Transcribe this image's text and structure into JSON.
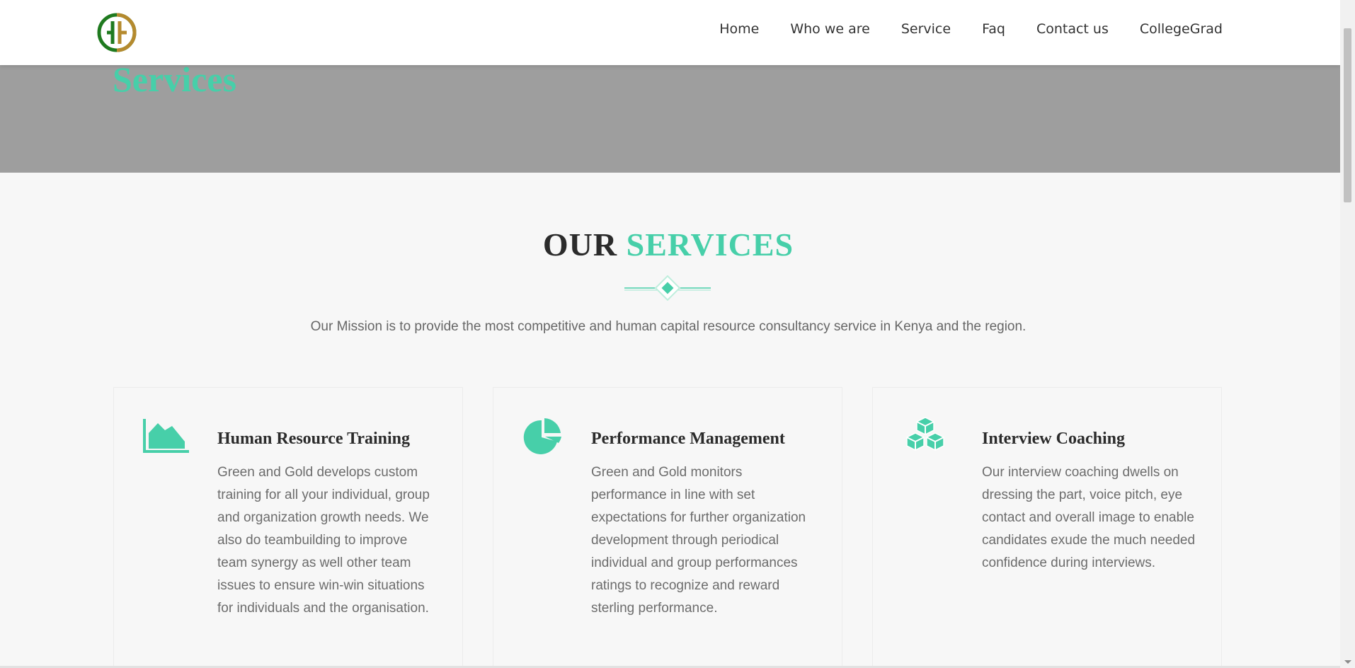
{
  "header": {
    "logo_alt": "Green and Gold logo",
    "nav": [
      "Home",
      "Who we are",
      "Service",
      "Faq",
      "Contact us",
      "CollegeGrad"
    ]
  },
  "hero": {
    "title": "Services"
  },
  "section": {
    "title_part1": "OUR",
    "title_part2": "SERVICES",
    "mission": "Our Mission is to provide the most competitive and human capital resource consultancy service in Kenya and the region."
  },
  "cards": [
    {
      "icon": "area-chart-icon",
      "title": "Human Resource Training",
      "text": "Green and Gold develops custom training for all your individual, group and organization growth needs. We also do teambuilding to improve team synergy as well other team issues to ensure win-win situations for individuals and the organisation."
    },
    {
      "icon": "pie-chart-icon",
      "title": "Performance Management",
      "text": "Green and Gold monitors performance in line with set expectations for further organization development through periodical individual and group performances ratings to recognize and reward sterling performance."
    },
    {
      "icon": "cubes-icon",
      "title": "Interview Coaching",
      "text": "Our interview coaching dwells on dressing the part, voice pitch, eye contact and overall image to enable candidates exude the much needed confidence during interviews."
    }
  ],
  "colors": {
    "accent": "#47cfa9",
    "hero_bg": "#9e9e9e",
    "logo_green": "#1f7a1f",
    "logo_gold": "#b58a2e"
  }
}
